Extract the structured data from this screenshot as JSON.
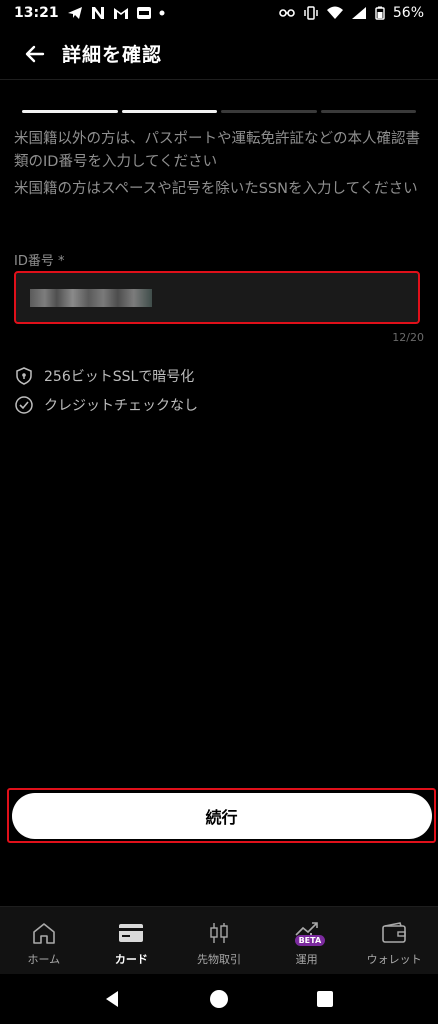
{
  "status_bar": {
    "time": "13:21",
    "battery_percent": "56%",
    "left_icons": [
      "telegram-icon",
      "n-icon",
      "gmail-icon",
      "ism-icon",
      "dot-icon"
    ],
    "right_icons": [
      "key-icon",
      "vibrate-icon",
      "wifi-icon",
      "signal-icon",
      "battery-icon"
    ]
  },
  "header": {
    "title": "詳細を確認"
  },
  "progress": {
    "total_steps": 4,
    "active_steps": 2
  },
  "info": {
    "line1": "米国籍以外の方は、パスポートや運転免許証などの本人確認書類のID番号を入力してください",
    "line2": "米国籍の方はスペースや記号を除いたSSNを入力してください"
  },
  "id_field": {
    "label": "ID番号 *",
    "counter": "12/20"
  },
  "features": [
    {
      "icon": "shield-icon",
      "label": "256ビットSSLで暗号化"
    },
    {
      "icon": "check-circle-icon",
      "label": "クレジットチェックなし"
    }
  ],
  "continue_button": {
    "label": "続行"
  },
  "bottom_nav": {
    "items": [
      {
        "icon": "home-icon",
        "label": "ホーム"
      },
      {
        "icon": "card-icon",
        "label": "カード",
        "active": true
      },
      {
        "icon": "candlestick-icon",
        "label": "先物取引"
      },
      {
        "icon": "growth-chart-icon",
        "label": "運用",
        "badge": "BETA"
      },
      {
        "icon": "wallet-icon",
        "label": "ウォレット"
      }
    ]
  },
  "colors": {
    "background": "#000000",
    "highlight": "#e0101a",
    "button": "#ffffff",
    "beta_badge": "#7b2a9e"
  }
}
